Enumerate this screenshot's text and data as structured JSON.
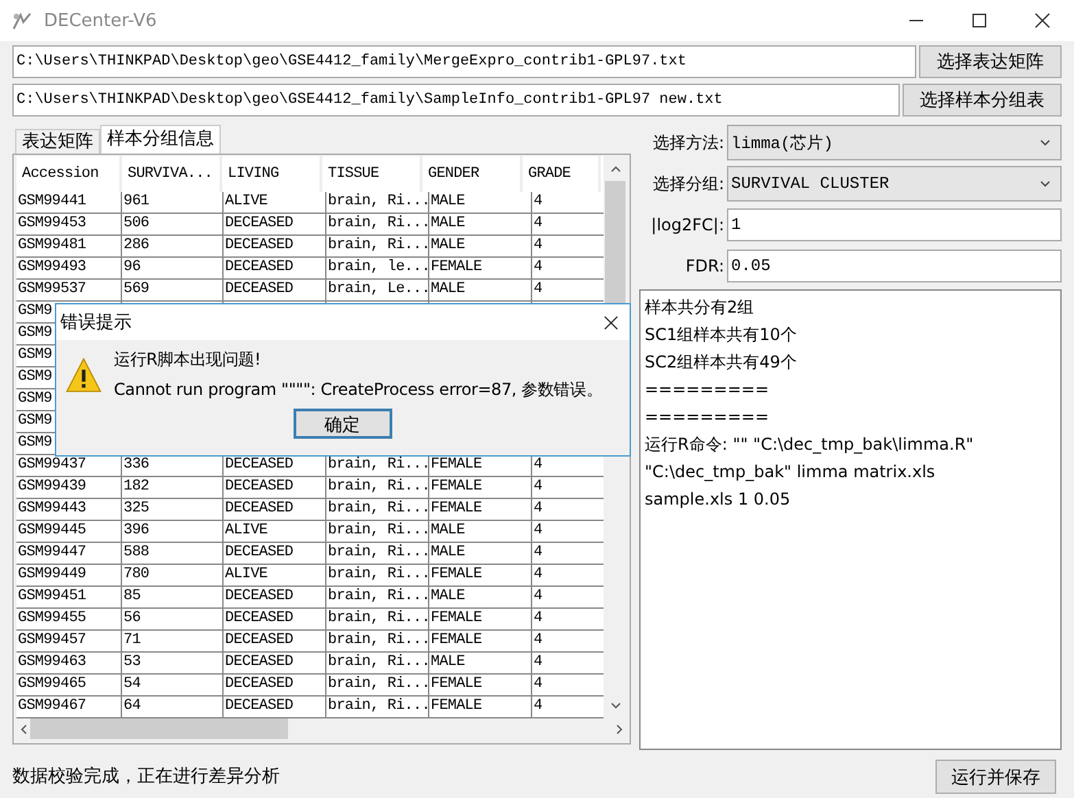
{
  "window": {
    "title": "DECenter-V6"
  },
  "files": [
    {
      "path": "C:\\Users\\THINKPAD\\Desktop\\geo\\GSE4412_family\\MergeExpro_contrib1-GPL97.txt",
      "button": "选择表达矩阵"
    },
    {
      "path": "C:\\Users\\THINKPAD\\Desktop\\geo\\GSE4412_family\\SampleInfo_contrib1-GPL97 new.txt",
      "button": "选择样本分组表"
    }
  ],
  "tabs": [
    {
      "label": "表达矩阵",
      "selected": false
    },
    {
      "label": "样本分组信息",
      "selected": true
    }
  ],
  "table": {
    "columns": [
      "Accession",
      "SURVIVA...",
      "LIVING",
      "TISSUE",
      "GENDER",
      "GRADE"
    ],
    "rows": [
      [
        "GSM99441",
        "961",
        "ALIVE",
        "brain, Ri...",
        "MALE",
        "4"
      ],
      [
        "GSM99453",
        "506",
        "DECEASED",
        "brain, Ri...",
        "MALE",
        "4"
      ],
      [
        "GSM99481",
        "286",
        "DECEASED",
        "brain, Ri...",
        "MALE",
        "4"
      ],
      [
        "GSM99493",
        "96",
        "DECEASED",
        "brain, le...",
        "FEMALE",
        "4"
      ],
      [
        "GSM99537",
        "569",
        "DECEASED",
        "brain, Le...",
        "MALE",
        "4"
      ],
      [
        "GSM9"
      ],
      [
        "GSM9"
      ],
      [
        "GSM9"
      ],
      [
        "GSM9"
      ],
      [
        "GSM9"
      ],
      [
        "GSM9"
      ],
      [
        "GSM9"
      ],
      [
        "GSM99437",
        "336",
        "DECEASED",
        "brain, Ri...",
        "FEMALE",
        "4"
      ],
      [
        "GSM99439",
        "182",
        "DECEASED",
        "brain, Ri...",
        "FEMALE",
        "4"
      ],
      [
        "GSM99443",
        "325",
        "DECEASED",
        "brain, Ri...",
        "FEMALE",
        "4"
      ],
      [
        "GSM99445",
        "396",
        "ALIVE",
        "brain, Ri...",
        "MALE",
        "4"
      ],
      [
        "GSM99447",
        "588",
        "DECEASED",
        "brain, Ri...",
        "MALE",
        "4"
      ],
      [
        "GSM99449",
        "780",
        "ALIVE",
        "brain, Ri...",
        "FEMALE",
        "4"
      ],
      [
        "GSM99451",
        "85",
        "DECEASED",
        "brain, Ri...",
        "MALE",
        "4"
      ],
      [
        "GSM99455",
        "56",
        "DECEASED",
        "brain, Ri...",
        "FEMALE",
        "4"
      ],
      [
        "GSM99457",
        "71",
        "DECEASED",
        "brain, Ri...",
        "FEMALE",
        "4"
      ],
      [
        "GSM99463",
        "53",
        "DECEASED",
        "brain, Ri...",
        "MALE",
        "4"
      ],
      [
        "GSM99465",
        "54",
        "DECEASED",
        "brain, Ri...",
        "FEMALE",
        "4"
      ],
      [
        "GSM99467",
        "64",
        "DECEASED",
        "brain, Ri...",
        "FEMALE",
        "4"
      ]
    ]
  },
  "settings": [
    {
      "kind": "select",
      "label": "选择方法:",
      "value": "limma(芯片)"
    },
    {
      "kind": "select",
      "label": "选择分组:",
      "value": "SURVIVAL CLUSTER"
    },
    {
      "kind": "input",
      "label": "|log2FC|:",
      "value": "1"
    },
    {
      "kind": "input",
      "label": "FDR:",
      "value": "0.05"
    }
  ],
  "log": [
    "样本共分有2组",
    "SC1组样本共有10个",
    "SC2组样本共有49个",
    "=========",
    "=========",
    "运行R命令: \"\" \"C:\\dec_tmp_bak\\limma.R\"",
    "\"C:\\dec_tmp_bak\" limma matrix.xls",
    "sample.xls 1 0.05"
  ],
  "status": "数据校验完成，正在进行差异分析",
  "run_button": "运行并保存",
  "dialog": {
    "title": "错误提示",
    "heading": "运行R脚本出现问题!",
    "message": "Cannot run program \"\"\"\": CreateProcess error=87, 参数错误。",
    "button": "确定"
  }
}
